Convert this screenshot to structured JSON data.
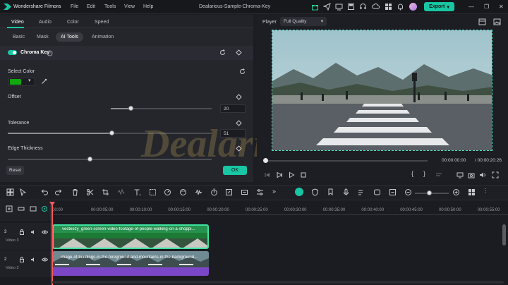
{
  "app": {
    "title": "Wondershare Filmora",
    "menu": [
      "File",
      "Edit",
      "Tools",
      "View",
      "Help"
    ],
    "project_title": "Dealarious-Sample-Chroma-Key",
    "export_label": "Export"
  },
  "left_panel": {
    "main_tabs": [
      "Video",
      "Audio",
      "Color",
      "Speed"
    ],
    "sub_tabs": [
      "Basic",
      "Mask",
      "AI Tools",
      "Animation"
    ],
    "active_sub_tab": "AI Tools",
    "section_title": "Chroma Key",
    "select_color_label": "Select Color",
    "selected_color": "#0fa80f",
    "offset_label": "Offset",
    "offset_value": "20",
    "offset_fraction": 0.2,
    "tolerance_label": "Tolerance",
    "tolerance_value": "51",
    "tolerance_fraction": 0.51,
    "edge_thickness_label": "Edge Thickness",
    "reset_label": "Reset",
    "ok_label": "OK"
  },
  "player": {
    "label": "Player",
    "quality": "Full Quality",
    "current_time": "00:00:00:00",
    "total_time": "/ 00:00:20:26"
  },
  "timeline": {
    "ruler": [
      "00:00",
      "00:00:05:00",
      "00:00:10:00",
      "00:00:15:00",
      "00:00:20:00",
      "00:00:25:00",
      "00:00:30:00",
      "00:00:35:00",
      "00:00:40:00",
      "00:00:45:00",
      "00:00:50:00",
      "00:00:55:00"
    ],
    "tracks": [
      {
        "number": "3",
        "name": "Video 3",
        "clip_title": "vecteezy_green-screen-video-footage-of-people-walking-on-a-shoppi..."
      },
      {
        "number": "2",
        "name": "Video 2",
        "clip_title": "image-of-buildings-in-the-foreground-and-mountains-in-the-background..."
      }
    ]
  },
  "watermark": "Dealarious",
  "colors": {
    "accent": "#18c6a3",
    "panel": "#25262c",
    "clip_green": "#2c6b43",
    "clip_purple": "#6b3fb0"
  }
}
